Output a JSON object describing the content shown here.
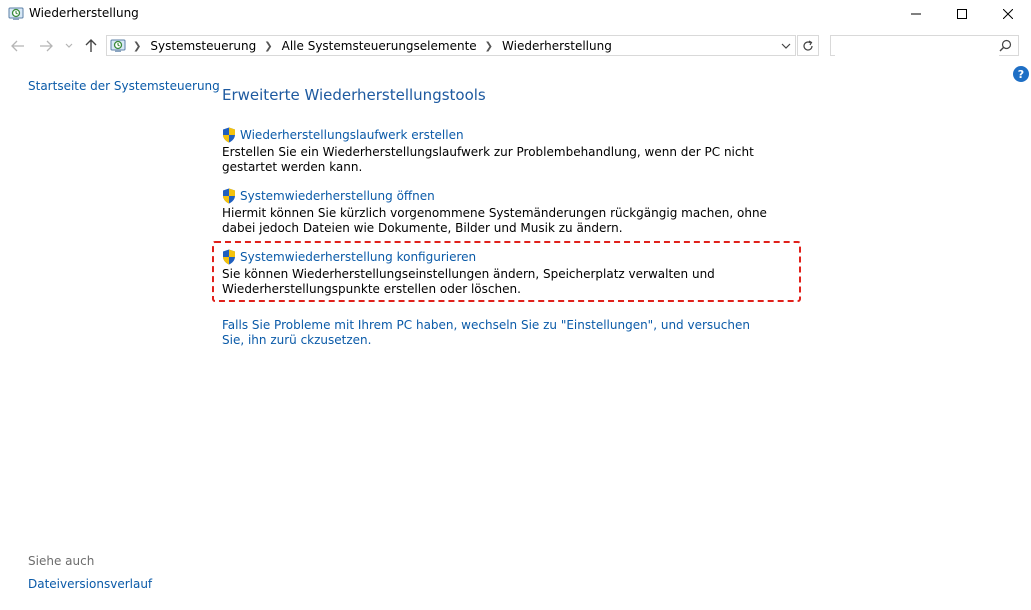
{
  "window": {
    "title": "Wiederherstellung"
  },
  "nav": {
    "breadcrumb": [
      "Systemsteuerung",
      "Alle Systemsteuerungselemente",
      "Wiederherstellung"
    ],
    "search_placeholder": "",
    "icons": {
      "back": "arrow-left-icon",
      "forward": "arrow-right-icon",
      "recent": "chevron-down-icon",
      "up": "arrow-up-icon",
      "refresh": "refresh-icon",
      "search": "search-icon"
    }
  },
  "sidebar": {
    "home_link": "Startseite der Systemsteuerung",
    "see_also_label": "Siehe auch",
    "see_also_link": "Dateiversionsverlauf"
  },
  "main": {
    "heading": "Erweiterte Wiederherstellungstools",
    "tools": [
      {
        "label": "Wiederherstellungslaufwerk erstellen",
        "desc": "Erstellen Sie ein Wiederherstellungslaufwerk zur Problembehandlung, wenn der PC nicht gestartet werden kann."
      },
      {
        "label": "Systemwiederherstellung öffnen",
        "desc": "Hiermit können Sie kürzlich vorgenommene Systemänderungen rückgängig machen, ohne dabei jedoch Dateien wie Dokumente, Bilder und Musik zu ändern."
      },
      {
        "label": "Systemwiederherstellung konfigurieren",
        "desc": "Sie können Wiederherstellungseinstellungen ändern, Speicherplatz verwalten und Wiederherstellungspunkte erstellen oder löschen."
      }
    ],
    "reset_link": "Falls Sie Probleme mit Ihrem PC haben, wechseln Sie zu \"Einstellungen\", und versuchen Sie, ihn zurü ckzusetzen."
  },
  "colors": {
    "link": "#0a5aa8",
    "heading": "#1e5aa0",
    "highlight": "#e0201a",
    "shield_blue": "#1f5fbf",
    "shield_yellow": "#f4c20d"
  },
  "help_glyph": "?"
}
